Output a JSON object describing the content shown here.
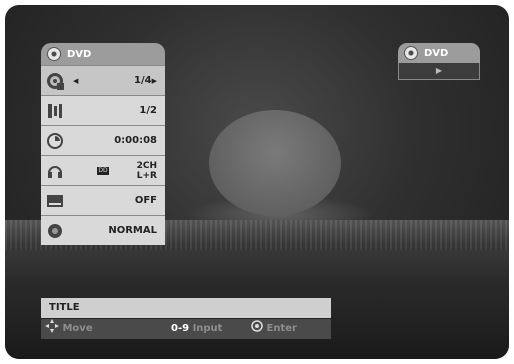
{
  "menu": {
    "title": "DVD",
    "rows": [
      {
        "icon": "title-disc-icon",
        "value": "1/4",
        "selected": true
      },
      {
        "icon": "chapter-icon",
        "value": "1/2"
      },
      {
        "icon": "clock-icon",
        "value": "0:00:08"
      },
      {
        "icon": "headphones-icon",
        "badge": "DD",
        "value_line1": "2CH",
        "value_line2": "L+R"
      },
      {
        "icon": "subtitle-icon",
        "value": "OFF"
      },
      {
        "icon": "speaker-icon",
        "value": "NORMAL"
      }
    ]
  },
  "status_box": {
    "title": "DVD",
    "play_symbol": "▶"
  },
  "bottom": {
    "title": "TITLE",
    "move_label": "Move",
    "input_key": "0-9",
    "input_label": "Input",
    "enter_label": "Enter"
  }
}
